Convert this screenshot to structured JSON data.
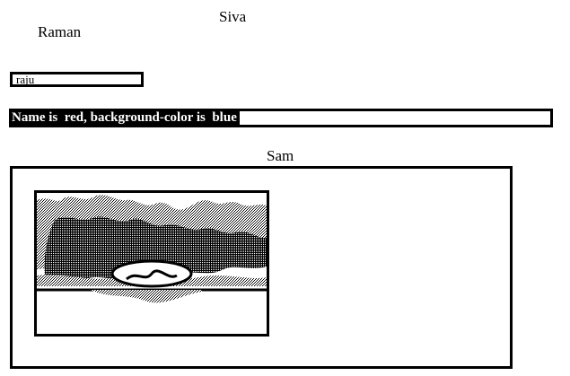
{
  "names": {
    "top_right": "Siva",
    "top_left": "Raman",
    "panel_label": "Sam"
  },
  "input": {
    "value": "raju"
  },
  "info_bar": {
    "text": "Name is  red, background-color is  blue"
  },
  "image": {
    "icon": "landscape-image-icon"
  }
}
